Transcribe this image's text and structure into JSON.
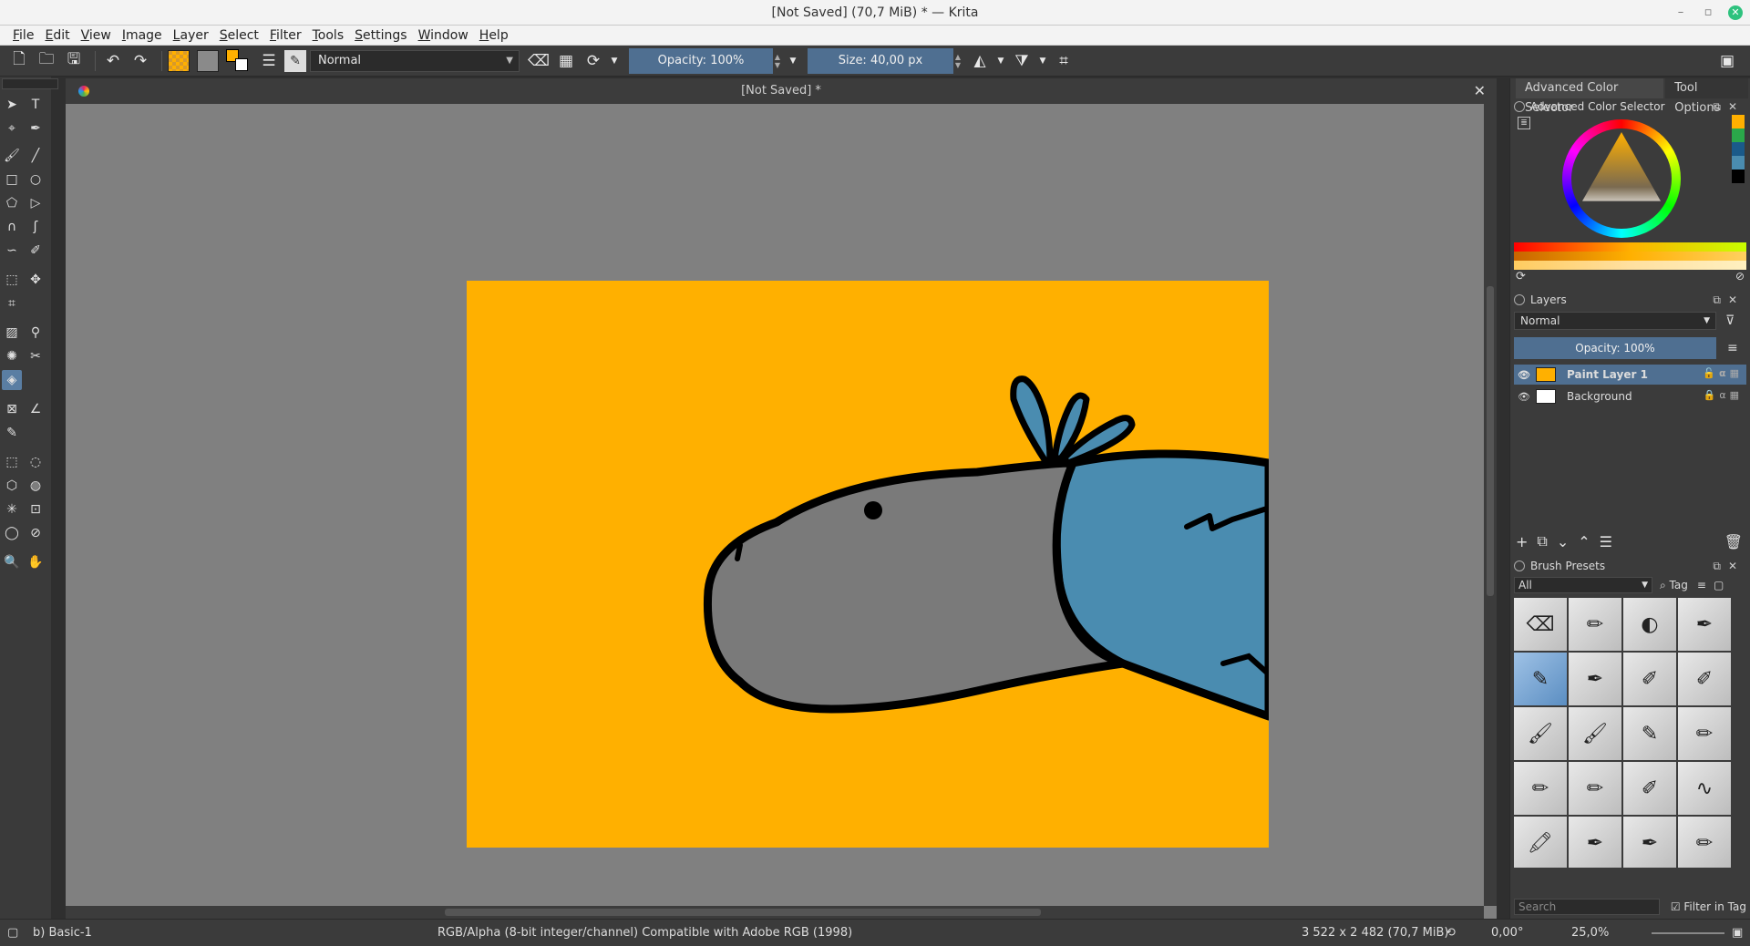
{
  "window": {
    "title": "[Not Saved]  (70,7 MiB)  * — Krita"
  },
  "menu": [
    "File",
    "Edit",
    "View",
    "Image",
    "Layer",
    "Select",
    "Filter",
    "Tools",
    "Settings",
    "Window",
    "Help"
  ],
  "toolbar": {
    "blend_mode": "Normal",
    "opacity": "Opacity: 100%",
    "size": "Size: 40,00 px",
    "fg_color": "#ffb000",
    "bg_color": "#ffffff"
  },
  "document": {
    "tab_title": "[Not Saved]  *",
    "canvas_color": "#ffb000"
  },
  "dock": {
    "tabs": [
      "Advanced Color Selector",
      "Tool Options"
    ],
    "color_selector": {
      "title": "Advanced Color Selector",
      "history": [
        "#ffb000",
        "#2aa84a",
        "#1a5a8a",
        "#4a8cb0",
        "#000000"
      ]
    },
    "layers": {
      "title": "Layers",
      "blend_mode": "Normal",
      "opacity": "Opacity:  100%",
      "items": [
        {
          "name": "Paint Layer 1",
          "active": true,
          "thumb": "#ffb000"
        },
        {
          "name": "Background",
          "active": false,
          "thumb": "#ffffff"
        }
      ]
    },
    "brushes": {
      "title": "Brush Presets",
      "filter": "All",
      "tag": "Tag",
      "search_placeholder": "Search",
      "filter_in_tag": "Filter in Tag"
    }
  },
  "status": {
    "brush": "b) Basic-1",
    "color_space": "RGB/Alpha (8-bit integer/channel)  Compatible with Adobe RGB (1998)",
    "image_size": "3 522 x 2 482 (70,7 MiB)",
    "rotation": "0,00°",
    "zoom": "25,0%"
  }
}
